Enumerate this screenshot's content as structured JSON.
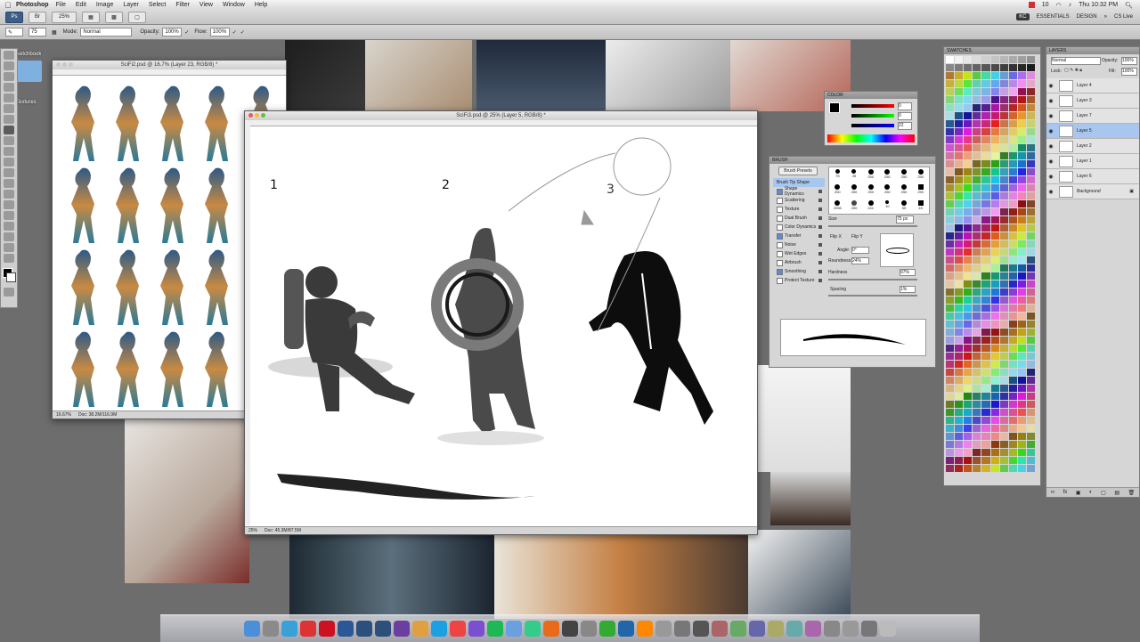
{
  "menubar": {
    "app": "Photoshop",
    "items": [
      "File",
      "Edit",
      "Image",
      "Layer",
      "Select",
      "Filter",
      "View",
      "Window",
      "Help"
    ],
    "clock": "Thu 10:32 PM",
    "battery_count": "10"
  },
  "appbar": {
    "ps": "Ps",
    "zoom": "25%",
    "workspace_user": "KC",
    "workspace_essentials": "ESSENTIALS",
    "workspace_design": "DESIGN",
    "cs_live": "CS Live"
  },
  "options": {
    "brush_size": "75",
    "mode_label": "Mode:",
    "mode_value": "Normal",
    "opacity_label": "Opacity:",
    "opacity_value": "100%",
    "flow_label": "Flow:",
    "flow_value": "100%"
  },
  "desktop": {
    "folder1": "Sketchbook",
    "folder2": "Textures"
  },
  "doc1": {
    "title": "SciFi2.psd @ 16.7% (Layer 23, RGB/8) *",
    "zoom": "16.67%",
    "doc_info": "Doc: 38.2M/116.9M"
  },
  "doc2": {
    "title": "SciFi3.psd @ 25% (Layer 5, RGB/8) *",
    "zoom": "25%",
    "doc_info": "Doc: 45.3M/87.5M",
    "sketch_numbers": [
      "1",
      "2",
      "3"
    ]
  },
  "color_panel": {
    "title": "COLOR",
    "r": "0",
    "g": "0",
    "b": "22"
  },
  "brush_panel": {
    "title": "BRUSH",
    "presets_button": "Brush Presets",
    "options": [
      {
        "label": "Brush Tip Shape",
        "checked": false,
        "selected": true
      },
      {
        "label": "Shape Dynamics",
        "checked": true
      },
      {
        "label": "Scattering",
        "checked": false
      },
      {
        "label": "Texture",
        "checked": false
      },
      {
        "label": "Dual Brush",
        "checked": false
      },
      {
        "label": "Color Dynamics",
        "checked": false
      },
      {
        "label": "Transfer",
        "checked": true
      },
      {
        "label": "Noise",
        "checked": false
      },
      {
        "label": "Wet Edges",
        "checked": false
      },
      {
        "label": "Airbrush",
        "checked": false
      },
      {
        "label": "Smoothing",
        "checked": true
      },
      {
        "label": "Protect Texture",
        "checked": false
      }
    ],
    "tip_sizes": [
      "75",
      "45",
      "250",
      "250",
      "250",
      "250",
      "250",
      "250",
      "250",
      "250",
      "250",
      "250",
      "2055",
      "250",
      "241",
      "10",
      "55",
      "49"
    ],
    "size_label": "Size",
    "size_value": "75 px",
    "flip_x": "Flip X",
    "flip_y": "Flip Y",
    "angle_label": "Angle:",
    "angle_value": "0°",
    "roundness_label": "Roundness:",
    "roundness_value": "24%",
    "hardness_label": "Hardness",
    "hardness_value": "97%",
    "spacing_label": "Spacing",
    "spacing_value": "1%"
  },
  "swatches_panel": {
    "title": "SWATCHES"
  },
  "layers_panel": {
    "title": "LAYERS",
    "mode": "Normal",
    "opacity_label": "Opacity:",
    "opacity_value": "100%",
    "lock_label": "Lock:",
    "fill_label": "Fill:",
    "fill_value": "100%",
    "layers": [
      "Layer 4",
      "Layer 3",
      "Layer 7",
      "Layer 5",
      "Layer 2",
      "Layer 1",
      "Layer 6",
      "Background"
    ],
    "selected": "Layer 5"
  },
  "dock_icons": [
    "finder",
    "launchpad",
    "safari-like",
    "calendar",
    "red-app",
    "word",
    "photoshop",
    "photoshop-2",
    "premiere",
    "preview",
    "skype",
    "ical",
    "itunes",
    "spotify",
    "mail",
    "maps",
    "firefox",
    "x11",
    "settings",
    "activity",
    "network",
    "vlc",
    "app",
    "app",
    "app",
    "app",
    "app",
    "app",
    "app",
    "app",
    "app",
    "app",
    "app",
    "app",
    "trash"
  ]
}
